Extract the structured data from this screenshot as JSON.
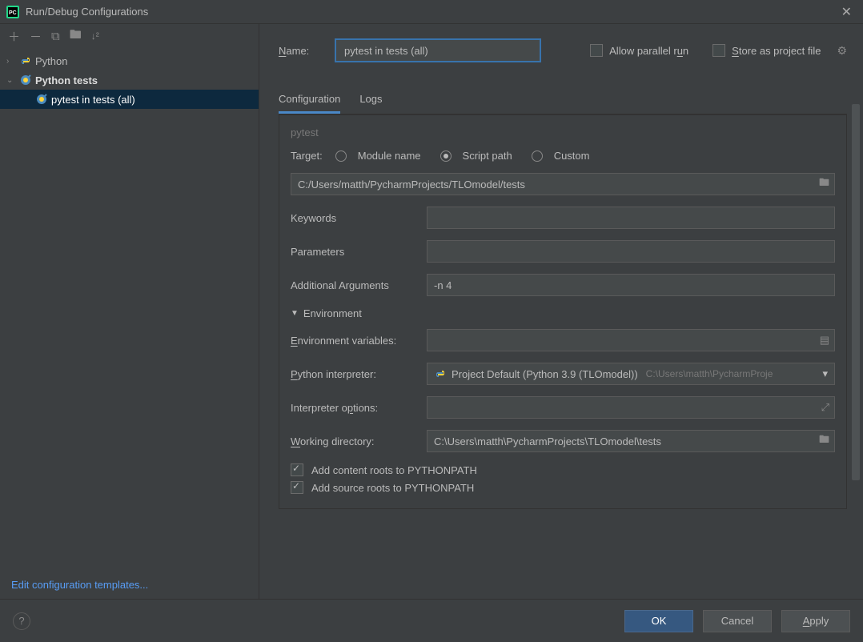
{
  "window": {
    "title": "Run/Debug Configurations"
  },
  "sidebar": {
    "items": [
      {
        "label": "Python",
        "expanded": false
      },
      {
        "label": "Python tests",
        "expanded": true
      },
      {
        "label": "pytest in tests (all)",
        "selected": true
      }
    ],
    "edit_templates": "Edit configuration templates..."
  },
  "form": {
    "name_label": "Name:",
    "name_value": "pytest in tests (all)",
    "allow_parallel_label": "Allow parallel run",
    "store_as_file_label": "Store as project file"
  },
  "tabs": {
    "configuration": "Configuration",
    "logs": "Logs"
  },
  "pytest": {
    "section_label": "pytest",
    "target_label": "Target:",
    "target_options": {
      "module": "Module name",
      "script": "Script path",
      "custom": "Custom"
    },
    "target_selected": "script",
    "script_path": "C:/Users/matth/PycharmProjects/TLOmodel/tests",
    "keywords_label": "Keywords",
    "keywords_value": "",
    "parameters_label": "Parameters",
    "parameters_value": "",
    "addl_args_label": "Additional Arguments",
    "addl_args_value": "-n 4"
  },
  "env": {
    "header": "Environment",
    "env_vars_label": "Environment variables:",
    "env_vars_value": "",
    "interpreter_label": "Python interpreter:",
    "interpreter_value": "Project Default (Python 3.9 (TLOmodel))",
    "interpreter_path": "C:\\Users\\matth\\PycharmProje",
    "interp_opts_label": "Interpreter options:",
    "interp_opts_value": "",
    "workdir_label": "Working directory:",
    "workdir_value": "C:\\Users\\matth\\PycharmProjects\\TLOmodel\\tests",
    "add_content_roots": "Add content roots to PYTHONPATH",
    "add_source_roots": "Add source roots to PYTHONPATH"
  },
  "footer": {
    "ok": "OK",
    "cancel": "Cancel",
    "apply": "Apply"
  }
}
